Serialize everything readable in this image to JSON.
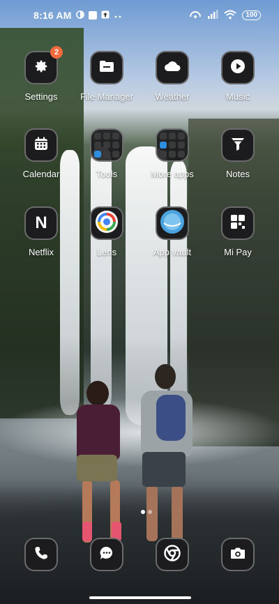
{
  "status_bar": {
    "time": "8:16 AM",
    "battery": "100"
  },
  "apps": {
    "settings": {
      "label": "Settings",
      "badge": "2"
    },
    "file_manager": {
      "label": "File Manager"
    },
    "weather": {
      "label": "Weather"
    },
    "music": {
      "label": "Music"
    },
    "calendar": {
      "label": "Calendar"
    },
    "tools": {
      "label": "Tools"
    },
    "more_apps": {
      "label": "More apps"
    },
    "notes": {
      "label": "Notes"
    },
    "netflix": {
      "label": "Netflix",
      "glyph": "N"
    },
    "lens": {
      "label": "Lens"
    },
    "app_vault": {
      "label": "App vault"
    },
    "mi_pay": {
      "label": "Mi Pay"
    }
  },
  "dock": [
    "phone-icon",
    "messages-icon",
    "chrome-icon",
    "camera-icon"
  ],
  "colors": {
    "badge": "#f26a3d",
    "tile": "#1c1c1e"
  }
}
